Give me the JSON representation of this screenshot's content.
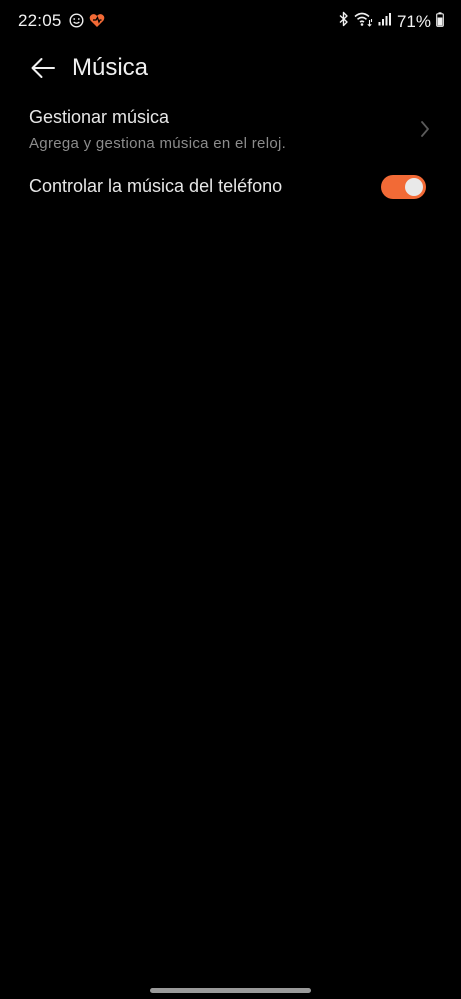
{
  "status_bar": {
    "time": "22:05",
    "battery": "71%",
    "icons": [
      "face-icon",
      "heart-tag-icon",
      "bluetooth-icon",
      "wifi-icon",
      "signal-icon",
      "battery-icon"
    ]
  },
  "header": {
    "title": "Música"
  },
  "settings": {
    "manage": {
      "title": "Gestionar música",
      "subtitle": "Agrega y gestiona música en el reloj."
    },
    "control": {
      "title": "Controlar la música del teléfono",
      "toggle_on": true
    }
  },
  "colors": {
    "accent": "#f26a36",
    "background": "#000000"
  }
}
